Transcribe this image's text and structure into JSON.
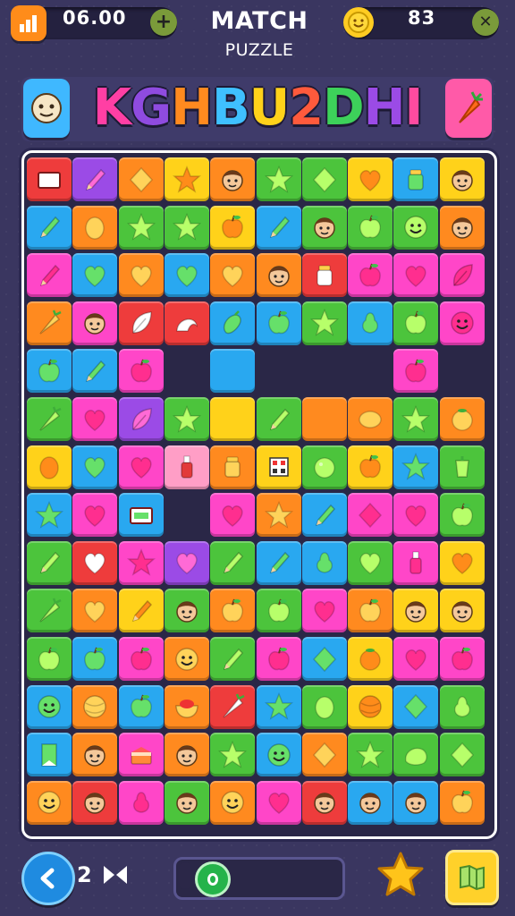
{
  "header": {
    "left_counter": "06.00",
    "right_counter": "83",
    "title_line1": "MATCH",
    "title_line2": "PUZZLE",
    "icons": [
      "bar-chart-icon",
      "add-icon",
      "smiley-coin-icon",
      "close-icon"
    ]
  },
  "logo": {
    "text": "KGHBU2DHI",
    "colors": [
      "#ff3fa4",
      "#8f4be0",
      "#ff8a1f",
      "#3fc0ff",
      "#ffd21a",
      "#ff5a3c",
      "#3dd15a",
      "#9b4be6",
      "#ff4ba0"
    ],
    "left_icon": "face-icon",
    "right_icon": "carrot-icon"
  },
  "board": {
    "rows": [
      [
        "red:frame",
        "purple:pencil",
        "orange:diamond",
        "yellow:star",
        "orange:face",
        "green:star",
        "green:diamond",
        "yellow:heart",
        "blue:jar",
        "yellow:face"
      ],
      [
        "blue:pencil",
        "orange:egg",
        "green:star",
        "green:star",
        "yellow:apple",
        "blue:pencil",
        "green:face",
        "green:apple",
        "green:smiley",
        "orange:face"
      ],
      [
        "magenta:pencil",
        "blue:heart",
        "orange:heart",
        "blue:heart",
        "orange:heart",
        "orange:face",
        "red:jar",
        "magenta:apple",
        "magenta:heart",
        "magenta:leaf"
      ],
      [
        "orange:carrot",
        "magenta:face",
        "red:leaf",
        "red:shell",
        "blue:eggplant",
        "blue:apple",
        "green:star",
        "blue:pear",
        "green:apple",
        "magenta:smiley"
      ],
      [
        "blue:apple",
        "blue:pencil",
        "magenta:apple",
        "empty",
        "blue:blank",
        "empty",
        "empty",
        "empty",
        "magenta:apple",
        "empty"
      ],
      [
        "green:carrot",
        "magenta:heart",
        "purple:leaf",
        "green:star",
        "yellow:blank",
        "green:pencil",
        "orange:blank",
        "orange:lemon",
        "green:star",
        "orange:fruit"
      ],
      [
        "yellow:egg",
        "blue:heart",
        "magenta:heart",
        "pink:bottle",
        "orange:jar",
        "yellow:tiles",
        "green:plum",
        "yellow:apple",
        "blue:star",
        "green:pepper"
      ],
      [
        "blue:star",
        "magenta:heart",
        "blue:frame",
        "empty",
        "magenta:heart",
        "orange:star",
        "blue:pencil",
        "magenta:diamond",
        "magenta:heart",
        "green:apple"
      ],
      [
        "green:pencil",
        "red:heart",
        "magenta:star",
        "purple:heart",
        "green:pencil",
        "blue:pencil",
        "blue:pear",
        "green:heart",
        "magenta:bottle",
        "yellow:heart"
      ],
      [
        "green:carrot",
        "orange:heart",
        "yellow:pencil",
        "green:face",
        "orange:apple",
        "green:apple",
        "magenta:heart",
        "orange:apple",
        "yellow:face",
        "yellow:face"
      ],
      [
        "green:apple",
        "blue:apple",
        "magenta:apple",
        "orange:smiley",
        "green:pencil",
        "magenta:apple",
        "blue:diamond",
        "yellow:fruit",
        "magenta:heart",
        "magenta:apple"
      ],
      [
        "blue:smiley",
        "orange:ball",
        "blue:apple",
        "orange:bowl",
        "red:carrot",
        "blue:star",
        "green:egg",
        "yellow:ball",
        "blue:diamond",
        "green:pear"
      ],
      [
        "blue:flag",
        "orange:face",
        "magenta:cake",
        "orange:face",
        "green:star",
        "blue:smiley",
        "orange:diamond",
        "green:star",
        "green:rock",
        "green:diamond"
      ],
      [
        "orange:smiley",
        "red:face",
        "magenta:pear",
        "green:face",
        "orange:smiley",
        "magenta:heart",
        "red:face",
        "blue:face",
        "blue:face",
        "orange:apple"
      ]
    ]
  },
  "footer": {
    "moves": "2",
    "progress": 0.08,
    "icons": [
      "back-arrow-icon",
      "skip-icon",
      "star-icon",
      "map-icon"
    ]
  },
  "colors": {
    "background": "#3a3660",
    "tile_palette": {
      "red": "#ee3c3c",
      "orange": "#ff8a1f",
      "yellow": "#ffd21a",
      "green": "#4cc43c",
      "blue": "#29a8f0",
      "purple": "#9b4be6",
      "magenta": "#ff46c8",
      "pink": "#ff9ec6"
    }
  }
}
